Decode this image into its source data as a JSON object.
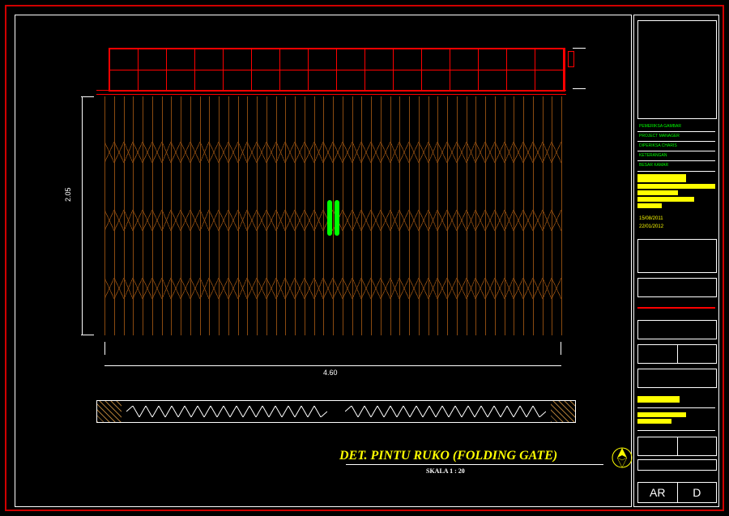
{
  "drawing": {
    "title": "DET. PINTU RUKO (FOLDING GATE)",
    "scale": "SKALA 1 : 20",
    "dim_height": "2.05",
    "dim_width": "4.60"
  },
  "chart_data": {
    "type": "table",
    "description": "CAD detail drawing of a shophouse folding gate (pintu ruko). Front elevation with transom grid above, scissor-lattice folding gate body and plan section below.",
    "dimensions": {
      "height_m": 2.05,
      "width_m": 4.6
    },
    "components": [
      "top transom grid (red)",
      "vertical slats with three cross-brace bands",
      "center pull handles (green, pair)",
      "plan section with wall hatching and zigzag track"
    ]
  },
  "title_block": {
    "rows": [
      "PEMERIKSA GAMBAR",
      "PROJECT MANAGER",
      "DIPERIKSA CHARIS",
      "KETERANGAN",
      "BESAR KAMAR"
    ],
    "dates": [
      "15/08/2011",
      "22/01/2012"
    ],
    "sheet_code_left": "AR",
    "sheet_code_right": "D"
  }
}
